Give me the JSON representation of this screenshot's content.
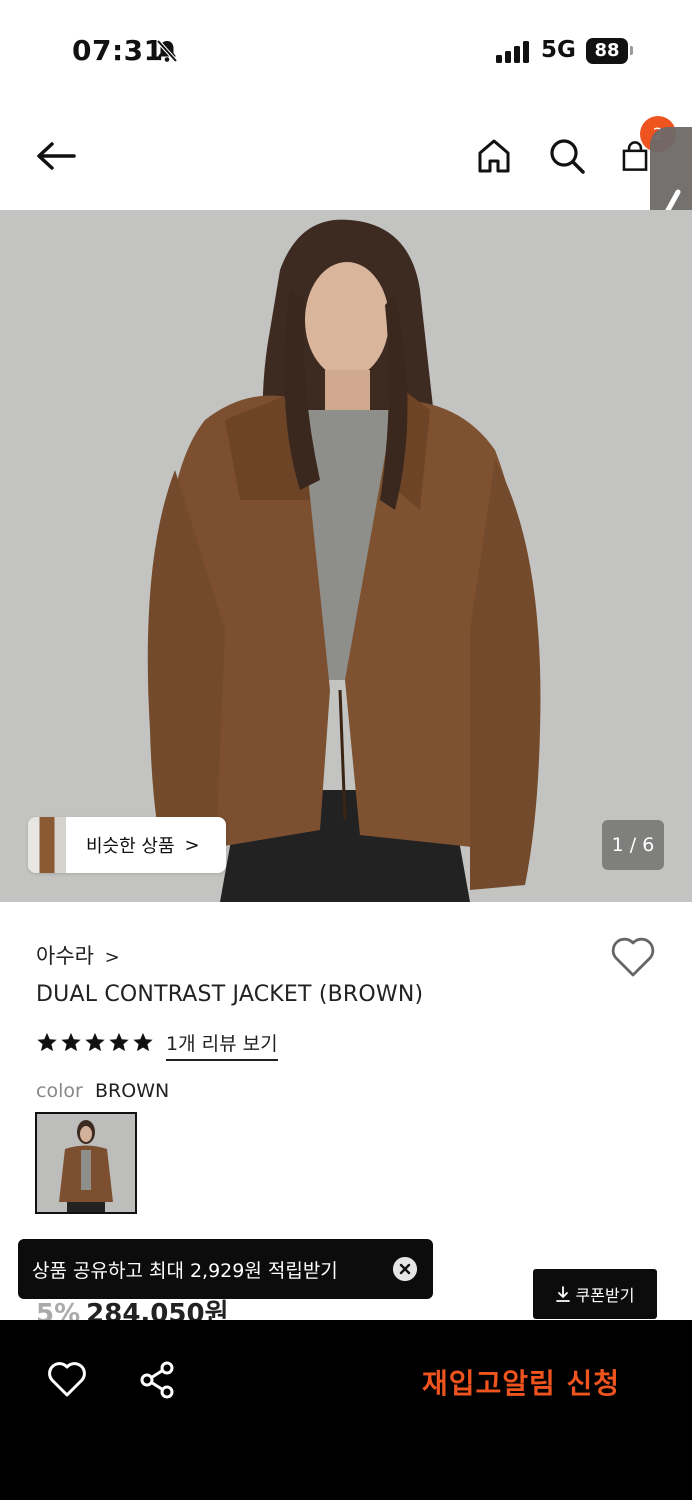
{
  "status_bar": {
    "time": "07:31",
    "network": "5G",
    "battery": "88"
  },
  "nav": {
    "cart_count": "2"
  },
  "hero": {
    "similar_label": "비슷한 상품",
    "similar_chevron": ">",
    "pager": "1 / 6"
  },
  "product": {
    "brand": "아수라",
    "brand_chevron": ">",
    "title": "DUAL CONTRAST JACKET (BROWN)",
    "rating_stars": 5,
    "review_link": "1개 리뷰 보기",
    "color_label": "color",
    "color_value": "BROWN",
    "discount": "5%",
    "price": "284,050원"
  },
  "toast": {
    "text": "상품 공유하고 최대 2,929원 적립받기"
  },
  "coupon": {
    "label": "쿠폰받기"
  },
  "bottom_bar": {
    "restock_label": "재입고알림 신청"
  },
  "colors": {
    "accent": "#f0541e",
    "bar": "#000000",
    "jacket": "#8a5a34"
  },
  "icons": [
    "bell-slash-icon",
    "signal-icon",
    "back-arrow-icon",
    "home-icon",
    "search-icon",
    "cart-icon",
    "chevron-left-icon",
    "heart-icon",
    "star-icon",
    "close-icon",
    "download-icon",
    "share-icon"
  ]
}
